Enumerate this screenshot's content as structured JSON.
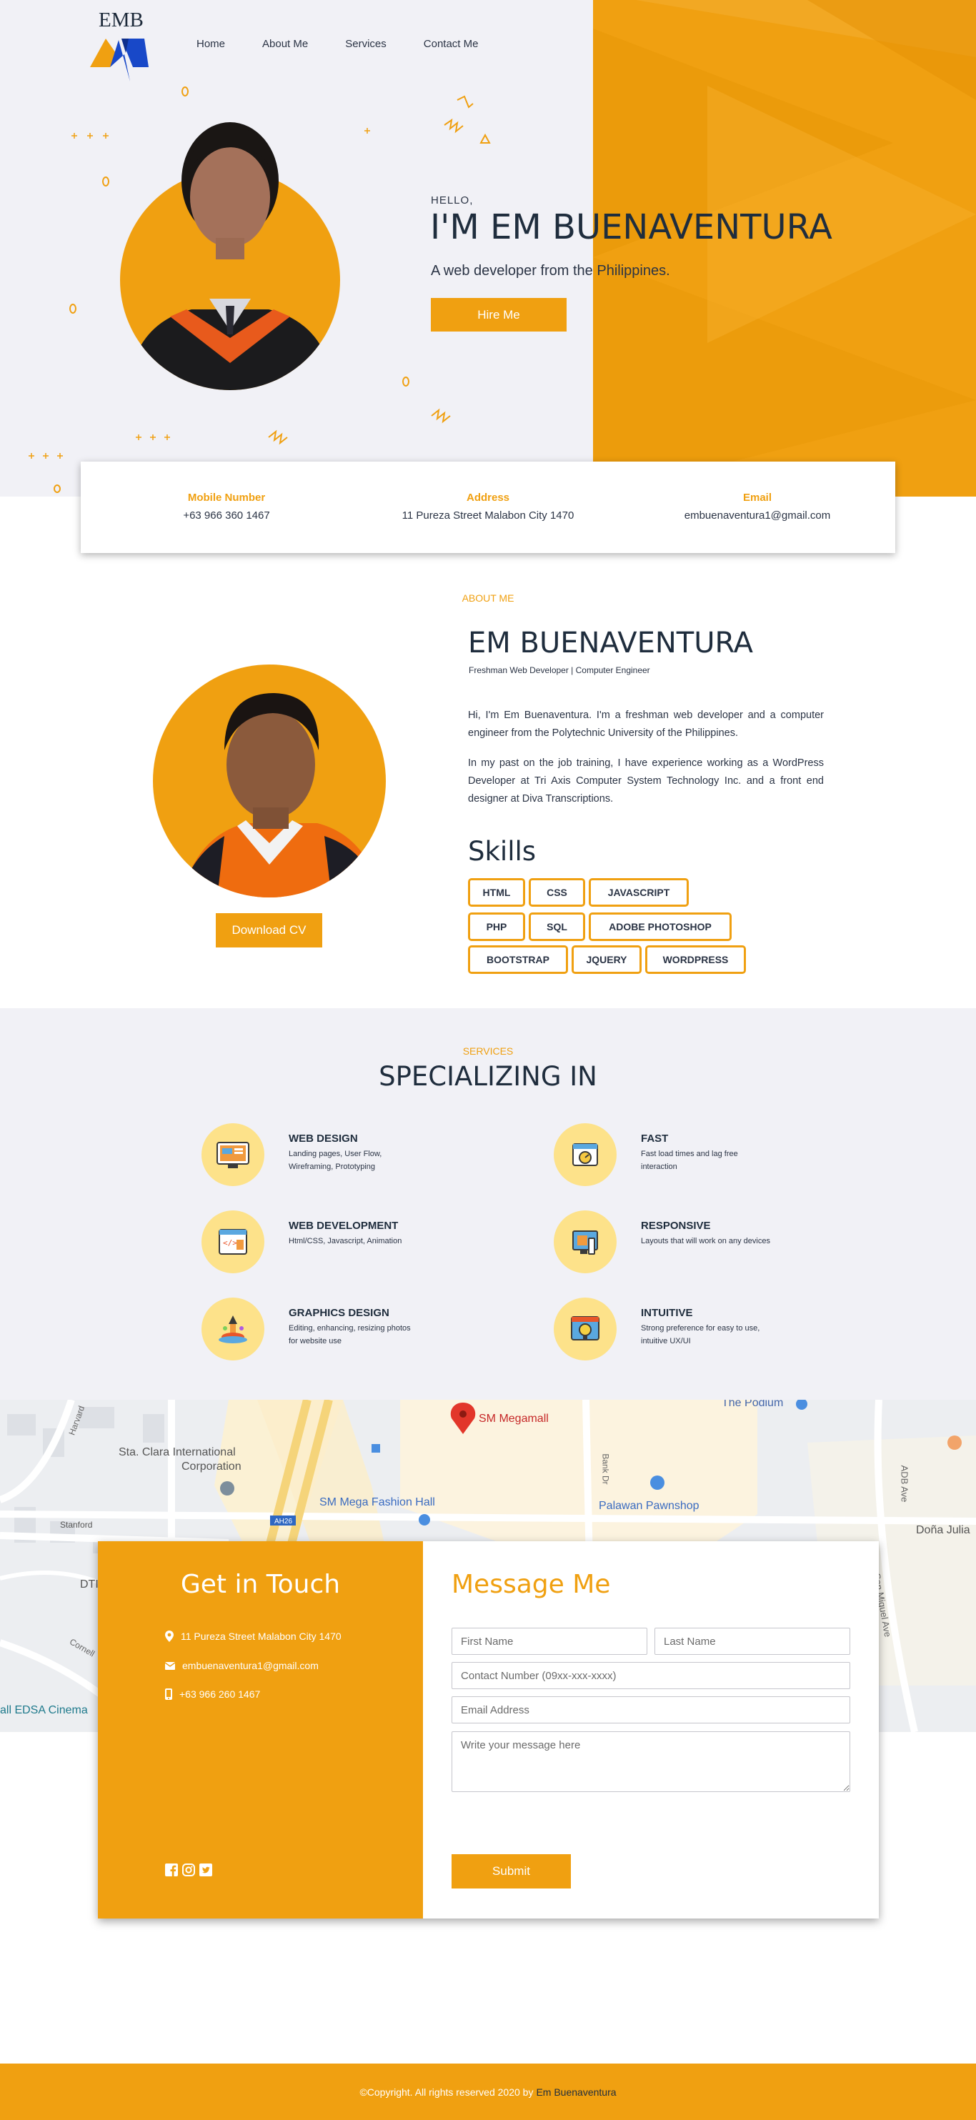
{
  "brand": {
    "logo_text": "EMB"
  },
  "nav": {
    "items": [
      {
        "label": "Home"
      },
      {
        "label": "About Me"
      },
      {
        "label": "Services"
      },
      {
        "label": "Contact Me"
      }
    ]
  },
  "hero": {
    "greeting": "HELLO,",
    "name": "I'M EM BUENAVENTURA",
    "subtitle": "A web developer from the Philippines.",
    "cta_label": "Hire Me"
  },
  "contact_strip": {
    "mobile_label": "Mobile Number",
    "mobile_value": "+63 966 360 1467",
    "address_label": "Address",
    "address_value": "11 Pureza Street Malabon City 1470",
    "email_label": "Email",
    "email_value": "embuenaventura1@gmail.com"
  },
  "about": {
    "eyebrow": "ABOUT ME",
    "name": "EM BUENAVENTURA",
    "role": "Freshman Web Developer | Computer Engineer",
    "paragraph1": "Hi, I'm Em Buenaventura. I'm a freshman web developer and a computer engineer from the Polytechnic University of the Philippines.",
    "paragraph2": "In my past on the job training, I have experience working as a WordPress Developer at Tri Axis Computer System Technology Inc. and a front end designer at Diva Transcriptions.",
    "cv_label": "Download CV",
    "skills_title": "Skills",
    "skills": [
      "HTML",
      "CSS",
      "JAVASCRIPT",
      "PHP",
      "SQL",
      "ADOBE PHOTOSHOP",
      "BOOTSTRAP",
      "JQUERY",
      "WORDPRESS"
    ]
  },
  "services": {
    "eyebrow": "SERVICES",
    "title": "SPECIALIZING IN",
    "items": [
      {
        "title": "WEB DESIGN",
        "desc": "Landing pages, User Flow, Wireframing, Prototyping",
        "icon": "web-design-icon"
      },
      {
        "title": "FAST",
        "desc": "Fast load times and lag free interaction",
        "icon": "fast-icon"
      },
      {
        "title": "WEB DEVELOPMENT",
        "desc": "Html/CSS, Javascript, Animation",
        "icon": "web-development-icon"
      },
      {
        "title": "RESPONSIVE",
        "desc": "Layouts that will work on any devices",
        "icon": "responsive-icon"
      },
      {
        "title": "GRAPHICS DESIGN",
        "desc": "Editing, enhancing, resizing photos for website use",
        "icon": "graphics-design-icon"
      },
      {
        "title": "INTUITIVE",
        "desc": "Strong preference for easy to use, intuitive UX/UI",
        "icon": "intuitive-icon"
      }
    ]
  },
  "map": {
    "labels": {
      "sm_megamall": "SM Megamall",
      "the_podium": "The Podium",
      "sta_clara_1": "Sta. Clara International",
      "sta_clara_2": "Corporation",
      "sm_fashion": "SM Mega Fashion Hall",
      "palawan": "Palawan Pawnshop",
      "adb_ave": "ADB Ave",
      "dona_julia": "Doña Julia",
      "stanford": "Stanford",
      "harvard": "Harvard",
      "bank_dr": "Bank Dr",
      "san_miguel": "San Miguel Ave",
      "edsa_cinema": "all EDSA Cinema",
      "ah26": "AH26",
      "dti": "DTI",
      "cornell": "Cornell"
    }
  },
  "contact": {
    "title": "Get in Touch",
    "address": "11 Pureza Street Malabon City 1470",
    "email": "embuenaventura1@gmail.com",
    "phone": "+63 966 260 1467",
    "form_title": "Message Me",
    "first_name_placeholder": "First Name",
    "last_name_placeholder": "Last Name",
    "contact_placeholder": "Contact Number (09xx-xxx-xxxx)",
    "email_placeholder": "Email Address",
    "message_placeholder": "Write your message here",
    "submit_label": "Submit"
  },
  "footer": {
    "copyright": "©Copyright. All rights reserved 2020 by",
    "owner": "Em Buenaventura"
  },
  "colors": {
    "accent": "#f0a011",
    "dark": "#1f2d3d",
    "light_bg": "#f1f1f6",
    "service_circle": "#fde28a"
  }
}
